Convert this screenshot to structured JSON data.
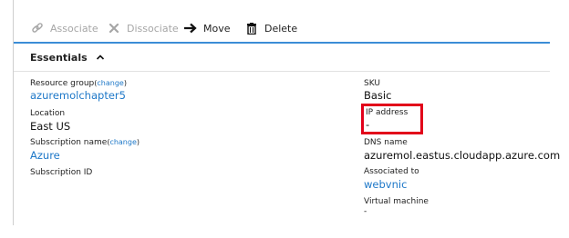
{
  "toolbar": {
    "associate_label": "Associate",
    "dissociate_label": "Dissociate",
    "move_label": "Move",
    "delete_label": "Delete"
  },
  "essentials": {
    "title": "Essentials"
  },
  "left": {
    "resource_group_label": "Resource group",
    "resource_group_change": "change",
    "resource_group_value": "azuremolchapter5",
    "location_label": "Location",
    "location_value": "East US",
    "subscription_name_label": "Subscription name",
    "subscription_name_change": "change",
    "subscription_name_value": "Azure",
    "subscription_id_label": "Subscription ID"
  },
  "right": {
    "sku_label": "SKU",
    "sku_value": "Basic",
    "ip_address_label": "IP address",
    "ip_address_value": "-",
    "dns_name_label": "DNS name",
    "dns_name_value": "azuremol.eastus.cloudapp.azure.com",
    "associated_to_label": "Associated to",
    "associated_to_value": "webvnic",
    "virtual_machine_label": "Virtual machine",
    "virtual_machine_value": "-"
  },
  "colors": {
    "accent_blue": "#3b8dd6",
    "link_blue": "#1e78c8",
    "highlight_red": "#e2001a",
    "disabled_gray": "#a6a6a6"
  }
}
